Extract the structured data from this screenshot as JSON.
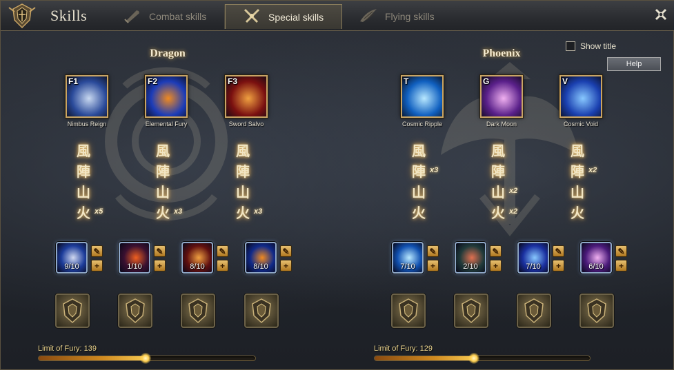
{
  "header": {
    "title": "Skills",
    "tabs": [
      {
        "label": "Combat skills",
        "icon": "sword-icon"
      },
      {
        "label": "Special skills",
        "icon": "crossed-swords-icon"
      },
      {
        "label": "Flying skills",
        "icon": "wing-icon"
      }
    ]
  },
  "options": {
    "show_title_label": "Show title",
    "show_title_checked": false,
    "help_label": "Help"
  },
  "panels": [
    {
      "name": "Dragon",
      "skills": [
        {
          "key": "F1",
          "label": "Nimbus Reign",
          "colors": [
            "#2a4a9a",
            "#c8d8f0"
          ]
        },
        {
          "key": "F2",
          "label": "Elemental Fury",
          "colors": [
            "#1c3cb8",
            "#f08a20"
          ]
        },
        {
          "key": "F3",
          "label": "Sword Salvo",
          "colors": [
            "#7a1010",
            "#f0a040"
          ]
        }
      ],
      "runes": [
        {
          "g1": "風",
          "g2": "陣",
          "g3": "山",
          "g4": "火",
          "mult": "x5",
          "mult_row": 4
        },
        {
          "g1": "風",
          "g2": "陣",
          "g3": "山",
          "g4": "火",
          "mult": "x3",
          "mult_row": 4
        },
        {
          "g1": "風",
          "g2": "陣",
          "g3": "山",
          "g4": "火",
          "mult": "x3",
          "mult_row": 4
        }
      ],
      "slots": [
        {
          "level": "9/10",
          "colors": [
            "#1c3c9a",
            "#d0d8f0"
          ]
        },
        {
          "level": "1/10",
          "colors": [
            "#3a1030",
            "#f06020"
          ]
        },
        {
          "level": "8/10",
          "colors": [
            "#601010",
            "#f0a040"
          ]
        },
        {
          "level": "8/10",
          "colors": [
            "#102a8a",
            "#f08a20"
          ]
        }
      ],
      "fury": {
        "label": "Limit of Fury: 139",
        "fraction": 0.49
      }
    },
    {
      "name": "Phoenix",
      "skills": [
        {
          "key": "T",
          "label": "Cosmic Ripple",
          "colors": [
            "#1060c0",
            "#b8e8ff"
          ]
        },
        {
          "key": "G",
          "label": "Dark Moon",
          "colors": [
            "#5a208a",
            "#f0b0f0"
          ]
        },
        {
          "key": "V",
          "label": "Cosmic Void",
          "colors": [
            "#1a40b0",
            "#88c8ff"
          ]
        }
      ],
      "runes": [
        {
          "g1": "風",
          "g2": "陣",
          "g3": "山",
          "g4": "火",
          "mult": "x3",
          "mult_row": 2
        },
        {
          "g1": "風",
          "g2": "陣",
          "g3": "山",
          "g4": "火",
          "mult": "x2",
          "mult_row": 3,
          "mult2": "x2",
          "mult2_row": 4
        },
        {
          "g1": "風",
          "g2": "陣",
          "g3": "山",
          "g4": "火",
          "mult": "x2",
          "mult_row": 2
        }
      ],
      "slots": [
        {
          "level": "7/10",
          "colors": [
            "#1050b0",
            "#b8e8ff"
          ]
        },
        {
          "level": "2/10",
          "colors": [
            "#203a3a",
            "#e07050"
          ]
        },
        {
          "level": "7/10",
          "colors": [
            "#1a30a0",
            "#88c8ff"
          ]
        },
        {
          "level": "6/10",
          "colors": [
            "#4a1a7a",
            "#f0b0f0"
          ]
        }
      ],
      "fury": {
        "label": "Limit of Fury: 129",
        "fraction": 0.46
      }
    }
  ]
}
